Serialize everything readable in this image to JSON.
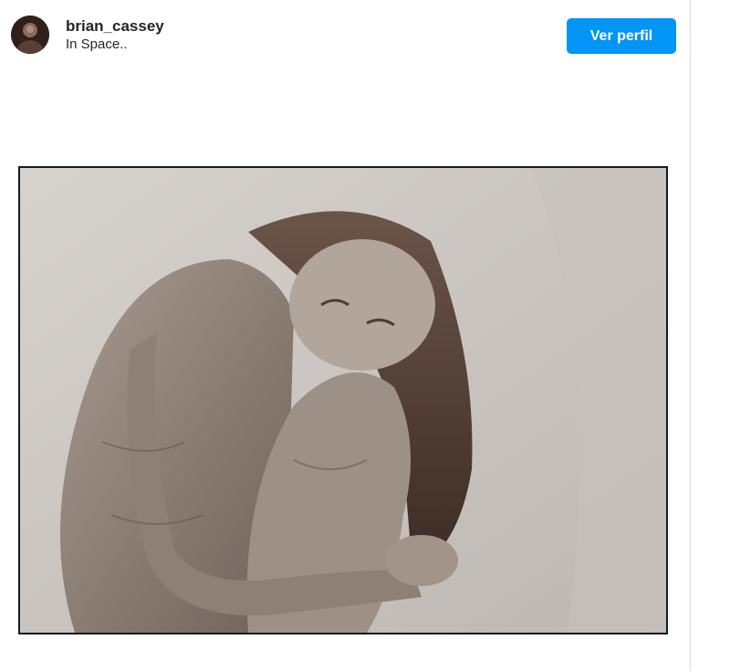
{
  "post": {
    "author": {
      "username": "brian_cassey",
      "location": "In Space..",
      "avatar_icon": "user-avatar"
    },
    "view_profile_label": "Ver perfil",
    "accent_color": "#0095f6",
    "media": {
      "kind": "photo",
      "tone": "sepia monochrome"
    }
  }
}
